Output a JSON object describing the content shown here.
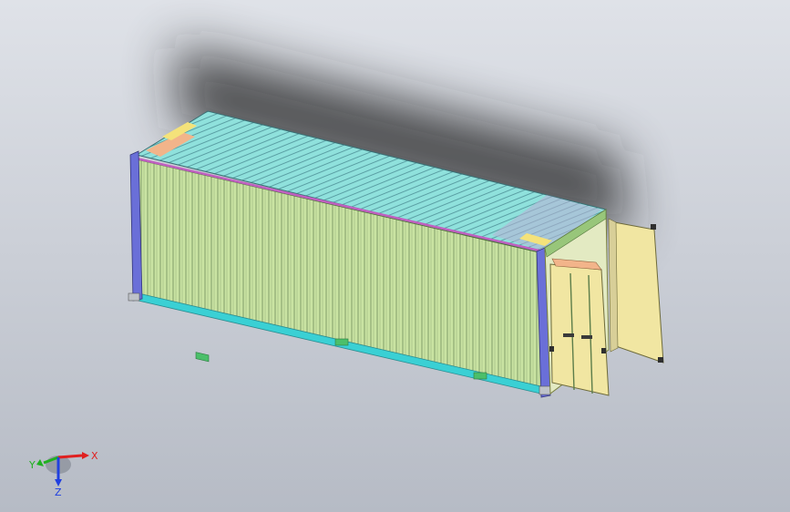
{
  "viewport": {
    "background_top": "#dfe2e8",
    "background_bottom": "#b7bcc6"
  },
  "model": {
    "side_panel_color": "#c9e3a2",
    "roof_panel_color": "#8ee0dc",
    "bottom_rail_color": "#3ad0d4",
    "top_rail_color": "#c060c0",
    "end_post_color": "#6a6fd8",
    "corner_fitting_color": "#f4e27a",
    "door_color": "#f1e6a2",
    "icons": [
      "cad-model",
      "container-door"
    ]
  },
  "triad": {
    "x_label": "X",
    "y_label": "Y",
    "z_label": "Z",
    "x_color": "#e02020",
    "y_color": "#20b020",
    "z_color": "#2040e0"
  }
}
